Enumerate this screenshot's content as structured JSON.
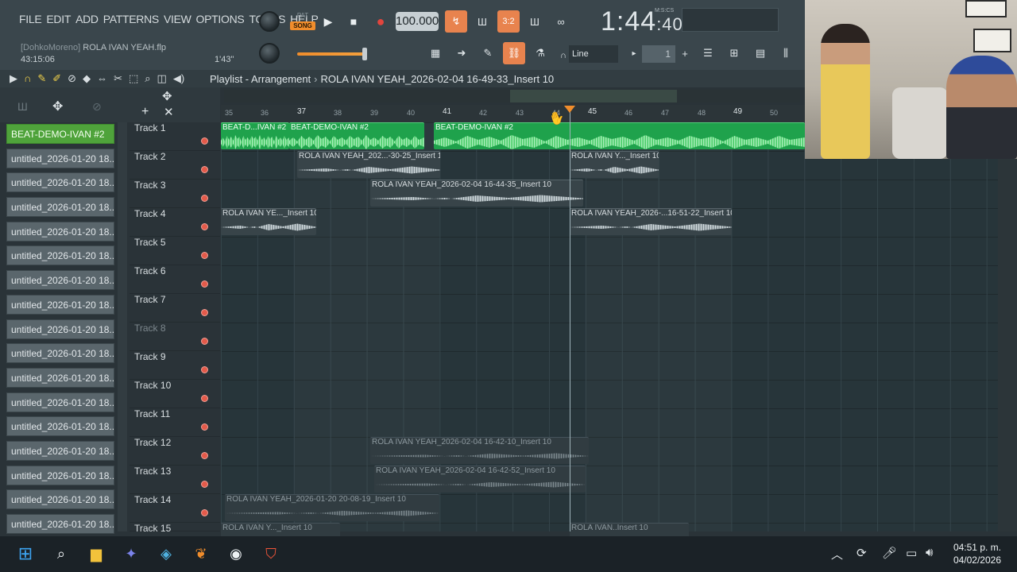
{
  "menu": [
    "FILE",
    "EDIT",
    "ADD",
    "PATTERNS",
    "VIEW",
    "OPTIONS",
    "TOOLS",
    "HELP"
  ],
  "project": {
    "author": "[DohkoMoreno]",
    "name": "ROLA IVAN YEAH.flp",
    "time": "43:15:06",
    "duration": "1'43\""
  },
  "transport": {
    "pat_label": "PAT",
    "song_label": "SONG",
    "tempo": "100.000",
    "clock_main": "1:44",
    "clock_small": ":40",
    "clock_unit": "M:S:CS"
  },
  "snap": {
    "mode": "Line",
    "value": "1"
  },
  "playlist": {
    "title": "Playlist - Arrangement",
    "arrangement": "ROLA IVAN YEAH_2026-02-04 16-49-33_Insert 10"
  },
  "patterns": [
    "BEAT-DEMO-IVAN #2",
    "untitled_2026-01-20 18...",
    "untitled_2026-01-20 18...",
    "untitled_2026-01-20 18...",
    "untitled_2026-01-20 18...",
    "untitled_2026-01-20 18...",
    "untitled_2026-01-20 18...",
    "untitled_2026-01-20 18...",
    "untitled_2026-01-20 18...",
    "untitled_2026-01-20 18...",
    "untitled_2026-01-20 18...",
    "untitled_2026-01-20 18...",
    "untitled_2026-01-20 18...",
    "untitled_2026-01-20 18...",
    "untitled_2026-01-20 18...",
    "untitled_2026-01-20 18...",
    "untitled_2026-01-20 18..."
  ],
  "tracks": [
    "Track 1",
    "Track 2",
    "Track 3",
    "Track 4",
    "Track 5",
    "Track 6",
    "Track 7",
    "Track 8",
    "Track 9",
    "Track 10",
    "Track 11",
    "Track 12",
    "Track 13",
    "Track 14",
    "Track 15"
  ],
  "ruler": [
    "35",
    "36",
    "37",
    "38",
    "39",
    "40",
    "41",
    "42",
    "43",
    "44",
    "45",
    "46",
    "47",
    "48",
    "49",
    "50"
  ],
  "clips": {
    "t1a": "BEAT-D...IVAN #2",
    "t1b": "BEAT-DEMO-IVAN #2",
    "t1c": "BEAT-DEMO-IVAN #2",
    "t2a": "ROLA IVAN YEAH_202...-30-25_Insert 10",
    "t2b": "ROLA IVAN Y..._Insert 10",
    "t3a": "ROLA IVAN YEAH_2026-02-04 16-44-35_Insert 10",
    "t4a": "ROLA IVAN YE..._Insert 10",
    "t4b": "ROLA IVAN YEAH_2026-...16-51-22_Insert 10",
    "t12a": "ROLA IVAN YEAH_2026-02-04 16-42-10_Insert 10",
    "t13a": "ROLA IVAN YEAH_2026-02-04 16-42-52_Insert 10",
    "t14a": "ROLA IVAN YEAH_2026-01-20 20-08-19_Insert 10",
    "t15a": "ROLA IVAN Y..._Insert 10",
    "t15b": "ROLA IVAN..Insert 10"
  },
  "taskbar": {
    "time": "04:51 p. m.",
    "date": "04/02/2026"
  },
  "colors": {
    "accent": "#f08d2c",
    "pattern_green": "#1fa24c",
    "active_pattern": "#4fa33b"
  }
}
